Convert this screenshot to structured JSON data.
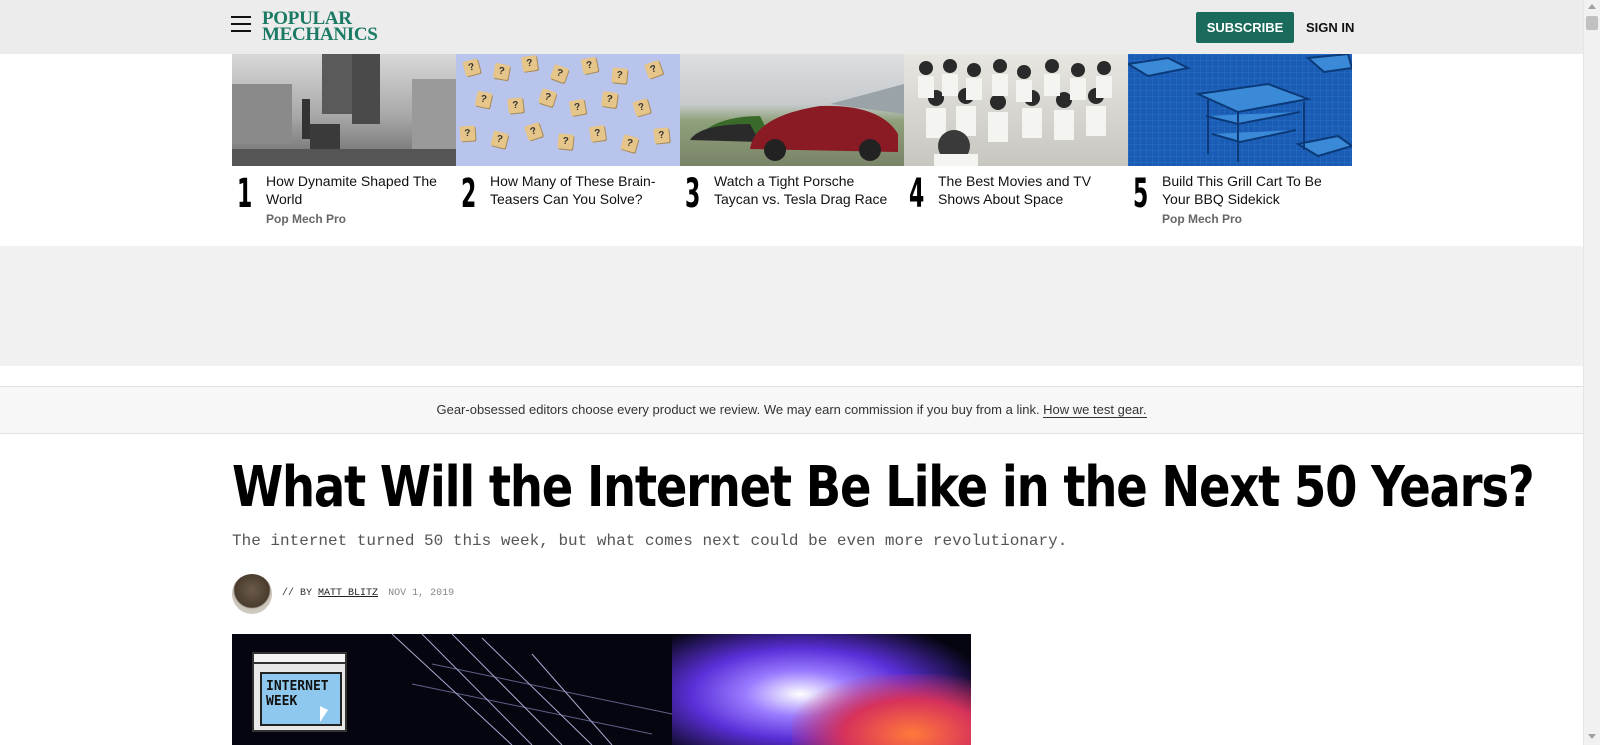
{
  "header": {
    "logo_line1": "POPULAR",
    "logo_line2": "MECHANICS",
    "subscribe_label": "SUBSCRIBE",
    "signin_label": "SIGN IN",
    "brand_color": "#1a6b5c"
  },
  "trending": [
    {
      "rank": "1",
      "title": "How Dynamite Shaped The World",
      "tag": "Pop Mech Pro"
    },
    {
      "rank": "2",
      "title": "How Many of These Brain-Teasers Can You Solve?",
      "tag": ""
    },
    {
      "rank": "3",
      "title": "Watch a Tight Porsche Taycan vs. Tesla Drag Race",
      "tag": ""
    },
    {
      "rank": "4",
      "title": "The Best Movies and TV Shows About Space",
      "tag": ""
    },
    {
      "rank": "5",
      "title": "Build This Grill Cart To Be Your BBQ Sidekick",
      "tag": "Pop Mech Pro"
    }
  ],
  "disclaimer": {
    "text": "Gear-obsessed editors choose every product we review. We may earn commission if you buy from a link. ",
    "link": "How we test gear."
  },
  "article": {
    "headline": "What Will the Internet Be Like in the Next 50 Years?",
    "dek": "The internet turned 50 this week, but what comes next could be even more revolutionary.",
    "byline_prefix": "// BY",
    "author": "MATT BLITZ",
    "date": "NOV 1, 2019",
    "hero_badge_line1": "INTERNET",
    "hero_badge_line2": "WEEK"
  }
}
